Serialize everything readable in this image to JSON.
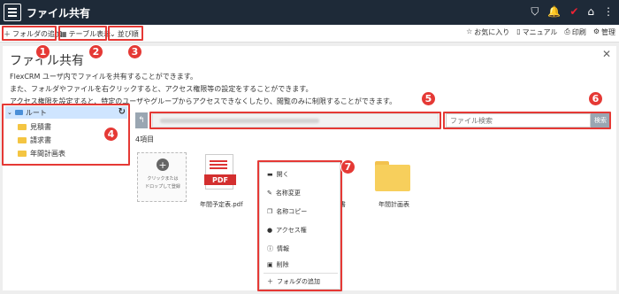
{
  "header": {
    "title": "ファイル共有",
    "icons": [
      "shield-icon",
      "bell-icon",
      "check-icon",
      "home-icon",
      "more-icon"
    ]
  },
  "toolbar": {
    "add_folder": "フォルダの追加",
    "table_view": "テーブル表示",
    "sort": "並び順",
    "favorites": "お気に入り",
    "manual": "マニュアル",
    "print": "印刷",
    "admin": "管理"
  },
  "panel": {
    "title": "ファイル共有",
    "desc_lines": [
      "FlexCRM ユーザ内でファイルを共有することができます。",
      "また、フォルダやファイルを右クリックすると、アクセス権限等の設定をすることができます。",
      "アクセス権限を設定すると、特定のユーザやグループからアクセスできなくしたり、閲覧のみに制限することができます。"
    ]
  },
  "tree": {
    "root": "ルート",
    "items": [
      "見積書",
      "請求書",
      "年間計画表"
    ]
  },
  "search": {
    "placeholder": "ファイル検索",
    "button": "検索"
  },
  "files": {
    "count": "4項目",
    "drop_line1": "クリックまたは",
    "drop_line2": "ドロップして登録",
    "pdf_badge": "PDF",
    "pdf_name": "年間予定表.pdf",
    "partial_name": "書",
    "folder_name": "年間計画表"
  },
  "context_menu": {
    "items": [
      "開く",
      "名称変更",
      "名称コピー",
      "アクセス権",
      "情報",
      "削除",
      "フォルダの追加"
    ]
  },
  "callouts": [
    "1",
    "2",
    "3",
    "4",
    "5",
    "6",
    "7"
  ],
  "colors": {
    "header_bg": "#1e2a38",
    "callout": "#e53935",
    "tree_selected": "#cfe5ff",
    "folder": "#f7cf5c",
    "pdf": "#d32f2f"
  }
}
